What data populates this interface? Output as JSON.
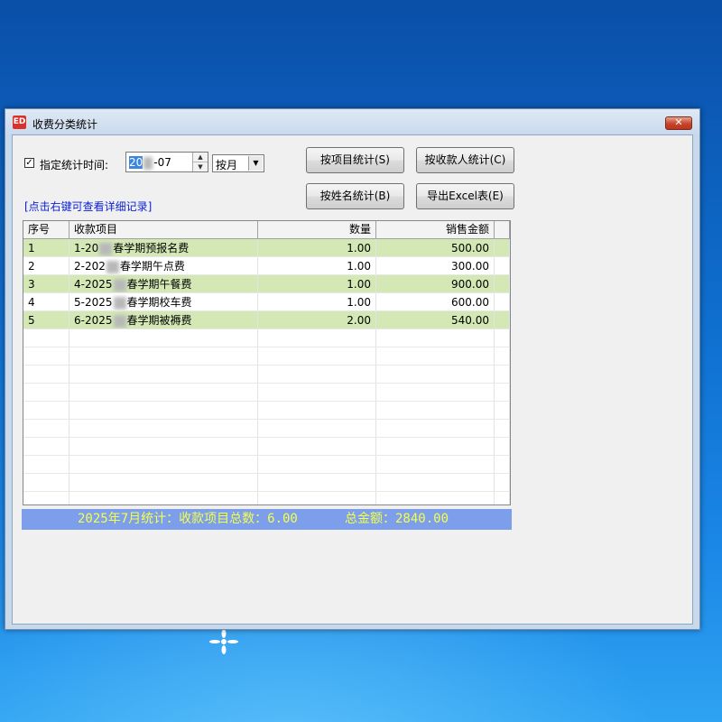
{
  "window": {
    "title": "收费分类统计",
    "app_icon_text": "ED",
    "close_glyph": "✕"
  },
  "filter": {
    "checkbox_checked": true,
    "checkbox_glyph": "✓",
    "label": "指定统计时间:",
    "date_prefix": "20",
    "date_suffix": "-07",
    "period_value": "按月"
  },
  "buttons": {
    "by_item": "按项目统计(S)",
    "by_payer": "按收款人统计(C)",
    "by_name": "按姓名统计(B)",
    "export": "导出Excel表(E)"
  },
  "hint_link": "[点击右键可查看详细记录]",
  "table": {
    "headers": [
      "序号",
      "收款项目",
      "数量",
      "销售金额"
    ],
    "rows": [
      {
        "no": "1",
        "item_a": "1-20",
        "item_b": "春学期预报名费",
        "qty": "1.00",
        "amount": "500.00"
      },
      {
        "no": "2",
        "item_a": "2-202",
        "item_b": "春学期午点费",
        "qty": "1.00",
        "amount": "300.00"
      },
      {
        "no": "3",
        "item_a": "4-2025",
        "item_b": "春学期午餐费",
        "qty": "1.00",
        "amount": "900.00"
      },
      {
        "no": "4",
        "item_a": "5-2025",
        "item_b": "春学期校车费",
        "qty": "1.00",
        "amount": "600.00"
      },
      {
        "no": "5",
        "item_a": "6-2025",
        "item_b": "春学期被褥费",
        "qty": "2.00",
        "amount": "540.00"
      }
    ]
  },
  "summary": {
    "count_text": "2025年7月统计：收款项目总数：6.00",
    "total_text": "总金额：2840.00"
  },
  "colors": {
    "row_alt": "#d3e8b5",
    "summary_bg": "#7c9eeb",
    "summary_fg": "#f4ff4a",
    "link": "#0b1fd6"
  }
}
